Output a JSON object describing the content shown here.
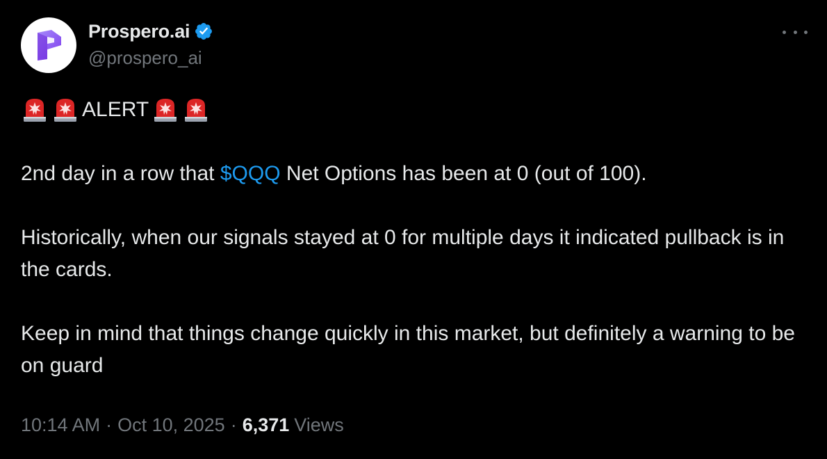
{
  "author": {
    "display_name": "Prospero.ai",
    "handle": "@prospero_ai",
    "verified": true,
    "avatar_icon": "prospero-logo-icon"
  },
  "tweet": {
    "alert_label": "ALERT",
    "alert_emoji": "rotating-light-icon",
    "line1_before": "2nd day in a row that ",
    "cashtag": "$QQQ",
    "line1_after": " Net Options has been at 0 (out of 100).",
    "para2": "Historically, when our signals stayed at 0 for multiple days it indicated pullback is in the cards.",
    "para3": "Keep in mind that things change quickly in this market, but definitely a warning to be on guard"
  },
  "meta": {
    "time": "10:14 AM",
    "date": "Oct 10, 2025",
    "views_count": "6,371",
    "views_label": "Views",
    "separator": "·"
  },
  "colors": {
    "background": "#000000",
    "text": "#e7e9ea",
    "secondary": "#71767b",
    "link": "#1d9bf0",
    "verified": "#1d9bf0",
    "logo_purple": "#8b5cf6"
  }
}
